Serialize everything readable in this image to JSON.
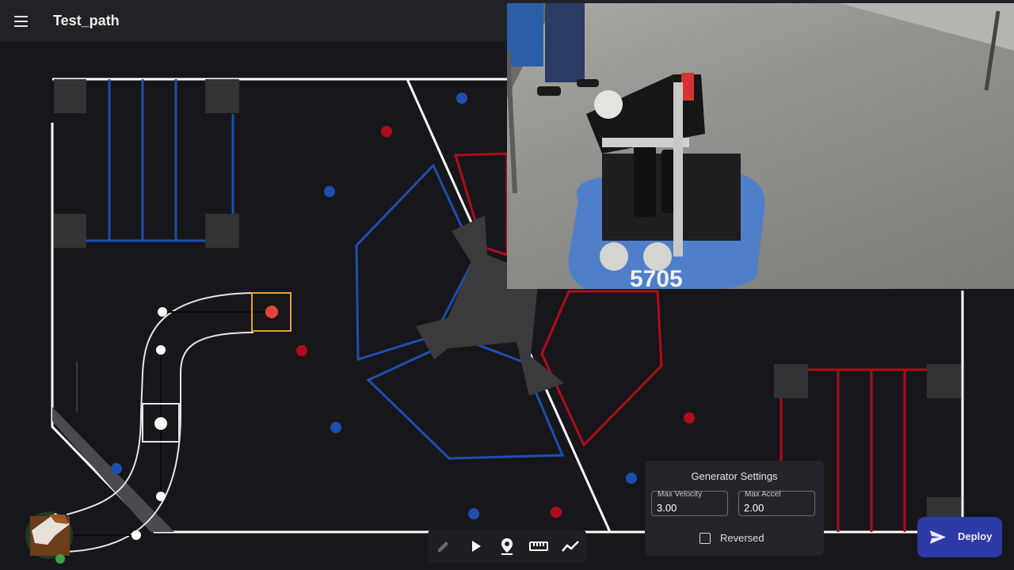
{
  "app": {
    "path_name": "Test_path"
  },
  "icons": {
    "menu": "menu-icon",
    "edit": "pencil-icon",
    "play": "play-icon",
    "waypoint": "location-pin-icon",
    "measure": "ruler-icon",
    "graph": "line-chart-icon",
    "deploy": "send-icon"
  },
  "video": {
    "robot_number": "5705"
  },
  "generator_settings": {
    "title": "Generator Settings",
    "max_velocity_label": "Max Velocity",
    "max_velocity_value": "3.00",
    "max_accel_label": "Max Accel",
    "max_accel_value": "2.00",
    "reversed_label": "Reversed",
    "reversed_checked": false
  },
  "deploy_label": "Deploy",
  "colors": {
    "blue_alliance": "#1e4fb0",
    "red_alliance": "#b00d1c",
    "selected_waypoint": "#e8a12c",
    "deploy_button": "#2e3aa6",
    "background": "#17171b"
  }
}
